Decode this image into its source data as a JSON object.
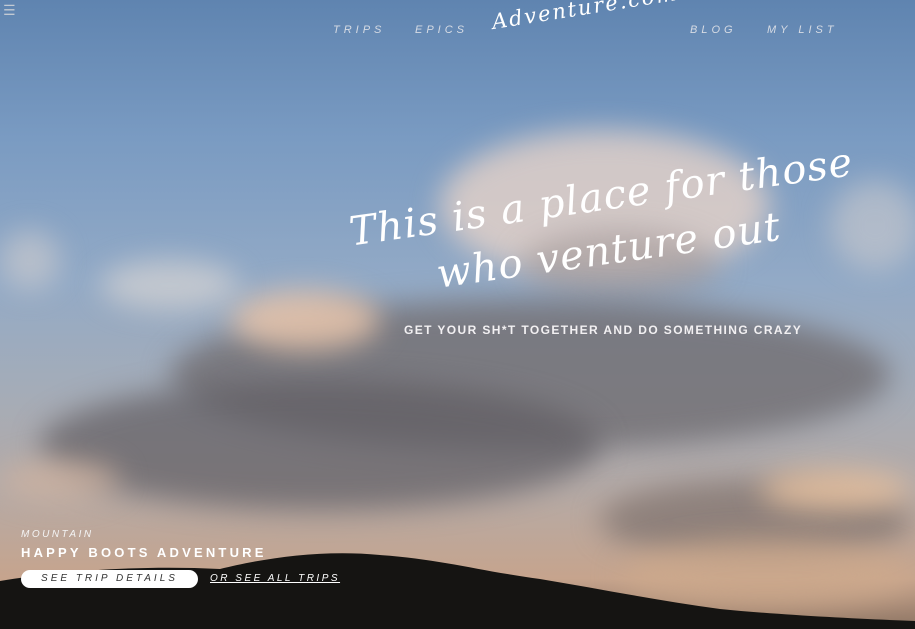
{
  "nav": {
    "menu_icon": "hamburger-icon",
    "items": [
      {
        "label": "TRIPS"
      },
      {
        "label": "EPICS"
      },
      {
        "label": "BLOG"
      },
      {
        "label": "MY LIST"
      }
    ],
    "logo": "Adventure.com"
  },
  "hero": {
    "headline_line1": "This is a place for those",
    "headline_line2": "who venture out",
    "subhead": "GET YOUR SH*T TOGETHER AND DO SOMETHING CRAZY"
  },
  "featured_trip": {
    "category": "MOUNTAIN",
    "title": "HAPPY BOOTS ADVENTURE",
    "details_button": "SEE TRIP DETAILS",
    "all_trips_link": "OR SEE ALL TRIPS"
  },
  "colors": {
    "sky_top": "#5f84b0",
    "text": "#ffffff",
    "hill": "#151412"
  }
}
